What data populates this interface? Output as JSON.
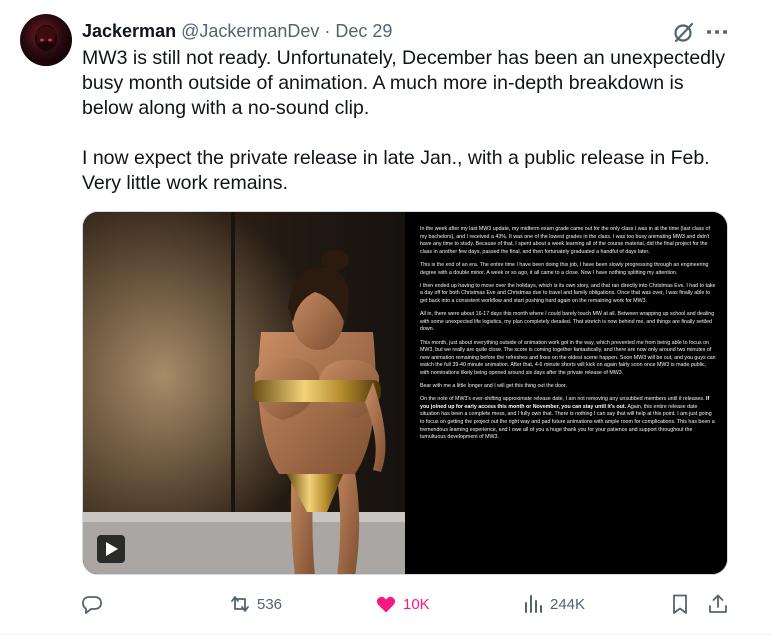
{
  "post": {
    "author_name": "Jackerman",
    "handle": "@JackermanDev",
    "separator": "·",
    "date": "Dec 29",
    "text_lines": [
      "MW3 is still not ready. Unfortunately, December has been an unexpectedly",
      "busy month outside of animation. A much more in-depth breakdown is",
      "below along with a no-sound clip.",
      "I now expect the private release in late Jan., with a public release in Feb.",
      "Very little work remains."
    ]
  },
  "media": {
    "notes": [
      "In the week after my last MW3 update, my midterm exam grade came out for the only class I was in at the time (last class of my bachelors), and I received a 43%. It was one of the lowest grades in the class. I was too busy animating MW3 and didn't have any time to study. Because of that, I spent about a week learning all of the course material, did the final project for the class in another few days, passed the final, and then fortunately graduated a handful of days later.",
      "This is the end of an era. The entire time I have been doing this job, I have been slowly progressing through an engineering degree with a double minor. A week or so ago, it all came to a close. Now I have nothing splitting my attention.",
      "I then ended up having to move over the holidays, which is its own story, and that ran directly into Christmas Eve. I had to take a day off for both Christmas Eve and Christmas due to travel and family obligations. Once that was over, I was finally able to get back into a consistent workflow and start pushing hard again on the remaining work for MW3.",
      "All in, there were about 16-17 days this month where I could barely touch MW at all. Between wrapping up school and dealing with some unexpected life logistics, my plan completely derailed. That stretch is now behind me, and things are finally settled down.",
      "This month, just about everything outside of animation work got in the way, which prevented me from being able to focus on MW3, but we really are quite close. The score is coming together fantastically, and there are now only around two minutes of new animation remaining before the refreshes and fixes on the oldest scene happen. Soon MW3 will be out, and you guys can watch the full 39-40 minute animation. After that, 4-6 minute shorts will kick on again fairly soon once MW3 is made public, with nominations likely being opened around six days after the private release of MW3.",
      "Bear with me a little longer and I will get this thing out the door.",
      "On the note of MW3's ever-shifting approximate release date, I am not removing any unsubbed members until it releases.",
      "If you joined up for early access this month or November, you can stay until it's out.",
      "Again, this entire release date situation has been a complete mess, and I fully own that. There is nothing I can say that will help at this point. I am just going to focus on getting the project out the right way and pad future animations with ample room for complications. This has been a tremendous learning experience, and I owe all of you a huge thank you for your patience and support throughout the tumultuous development of MW3."
    ],
    "video_control": "play-icon"
  },
  "actions": {
    "reply_count": "",
    "repost_count": "536",
    "like_count": "10K",
    "view_count": "244K"
  },
  "colors": {
    "text_primary": "#0f1419",
    "text_secondary": "#536471",
    "like_active": "#f91880",
    "border": "#cfd9de"
  },
  "icons": [
    "grok-icon",
    "more-icon",
    "reply-icon",
    "repost-icon",
    "heart-icon",
    "views-icon",
    "bookmark-icon",
    "share-icon",
    "play-icon"
  ]
}
